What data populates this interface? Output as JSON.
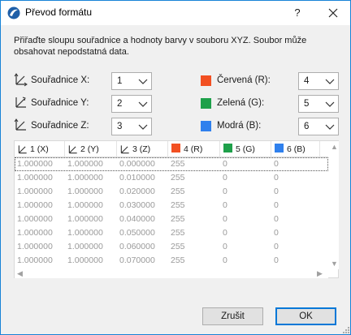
{
  "window": {
    "title": "Převod formátu",
    "help_label": "?"
  },
  "description": "Přiřaďte sloupu souřadnice a hodnoty barvy v souboru XYZ. Soubor může obsahovat nepodstatná data.",
  "mapping": {
    "coords": [
      {
        "label": "Souřadnice X:",
        "value": "1"
      },
      {
        "label": "Souřadnice Y:",
        "value": "2"
      },
      {
        "label": "Souřadnice Z:",
        "value": "3"
      }
    ],
    "colors": [
      {
        "label": "Červená (R):",
        "value": "4",
        "color": "#f25022"
      },
      {
        "label": "Zelená (G):",
        "value": "5",
        "color": "#1ea04a"
      },
      {
        "label": "Modrá (B):",
        "value": "6",
        "color": "#2f80ed"
      }
    ]
  },
  "table": {
    "headers": [
      "1 (X)",
      "2 (Y)",
      "3 (Z)",
      "4 (R)",
      "5 (G)",
      "6 (B)"
    ],
    "header_colors": [
      "",
      "",
      "",
      "#f25022",
      "#1ea04a",
      "#2f80ed"
    ],
    "rows": [
      [
        "1.000000",
        "1.000000",
        "0.000000",
        "255",
        "0",
        "0"
      ],
      [
        "1.000000",
        "1.000000",
        "0.010000",
        "255",
        "0",
        "0"
      ],
      [
        "1.000000",
        "1.000000",
        "0.020000",
        "255",
        "0",
        "0"
      ],
      [
        "1.000000",
        "1.000000",
        "0.030000",
        "255",
        "0",
        "0"
      ],
      [
        "1.000000",
        "1.000000",
        "0.040000",
        "255",
        "0",
        "0"
      ],
      [
        "1.000000",
        "1.000000",
        "0.050000",
        "255",
        "0",
        "0"
      ],
      [
        "1.000000",
        "1.000000",
        "0.060000",
        "255",
        "0",
        "0"
      ],
      [
        "1.000000",
        "1.000000",
        "0.070000",
        "255",
        "0",
        "0"
      ]
    ]
  },
  "buttons": {
    "cancel": "Zrušit",
    "ok": "OK"
  }
}
